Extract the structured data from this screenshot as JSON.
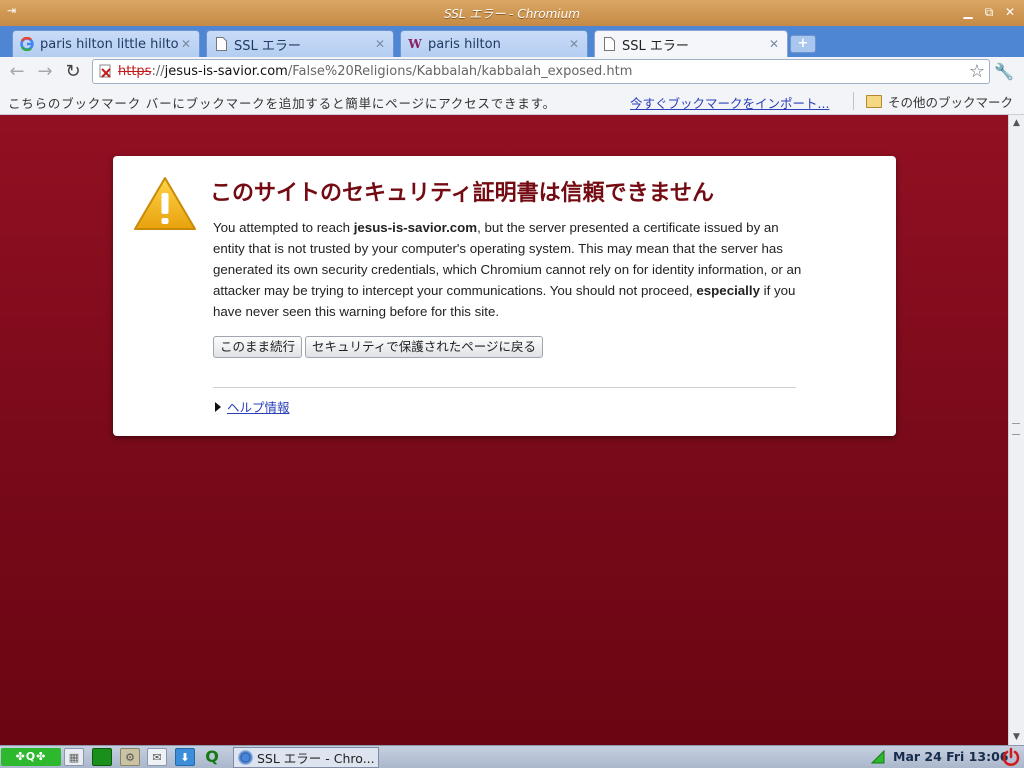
{
  "window": {
    "title": "SSL エラー - Chromium",
    "system_icon": "window-menu-icon",
    "controls": [
      "minimize",
      "maximize",
      "close"
    ]
  },
  "tabs": [
    {
      "label": "paris hilton little hilto…",
      "icon": "google-g-icon",
      "active": false
    },
    {
      "label": "SSL エラー",
      "icon": "page-icon",
      "active": false
    },
    {
      "label": "paris hilton",
      "icon": "wikipedia-w-icon",
      "active": false
    },
    {
      "label": "SSL エラー",
      "icon": "page-icon",
      "active": true
    }
  ],
  "toolbar": {
    "url_scheme": "https",
    "url_sep": "://",
    "url_host": "jesus-is-savior.com",
    "url_path": "/False%20Religions/Kabbalah/kabbalah_exposed.htm"
  },
  "bookmarks": {
    "message": "こちらのブックマーク バーにブックマークを追加すると簡単にページにアクセスできます。",
    "import_link": "今すぐブックマークをインポート...",
    "other": "その他のブックマーク"
  },
  "interstitial": {
    "heading": "このサイトのセキュリティ証明書は信頼できません",
    "p1": "You attempted to reach ",
    "host": "jesus-is-savior.com",
    "p2": ", but the server presented a certificate issued by an entity that is not trusted by your computer's operating system. This may mean that the server has generated its own security credentials, which Chromium cannot rely on for identity information, or an attacker may be trying to intercept your communications. You should not proceed, ",
    "emphasis": "especially",
    "p3": " if you have never seen this warning before for this site.",
    "proceed_button": "このまま続行",
    "back_button": "セキュリティで保護されたページに戻る",
    "help_link": "ヘルプ情報"
  },
  "taskbar": {
    "active_window": "SSL エラー - Chro...",
    "clock": "Mar 24 Fri 13:06"
  },
  "colors": {
    "page_background": "#7b0b1c",
    "heading": "#740b12",
    "link": "#2a3fb8",
    "titlebar": "#c58a45",
    "tabstrip": "#4f86d3"
  }
}
